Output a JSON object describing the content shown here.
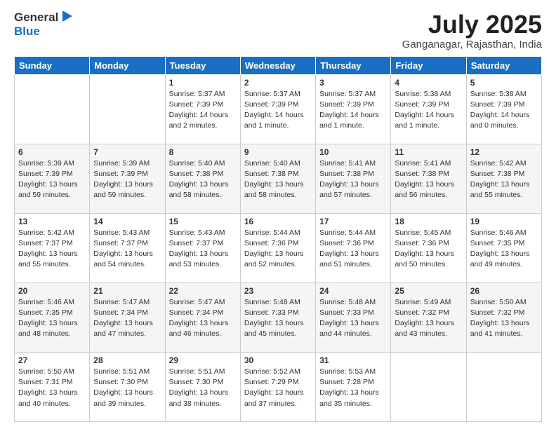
{
  "header": {
    "logo_line1": "General",
    "logo_line2": "Blue",
    "month_title": "July 2025",
    "subtitle": "Ganganagar, Rajasthan, India"
  },
  "days_of_week": [
    "Sunday",
    "Monday",
    "Tuesday",
    "Wednesday",
    "Thursday",
    "Friday",
    "Saturday"
  ],
  "weeks": [
    [
      {
        "day": "",
        "info": ""
      },
      {
        "day": "",
        "info": ""
      },
      {
        "day": "1",
        "info": "Sunrise: 5:37 AM\nSunset: 7:39 PM\nDaylight: 14 hours\nand 2 minutes."
      },
      {
        "day": "2",
        "info": "Sunrise: 5:37 AM\nSunset: 7:39 PM\nDaylight: 14 hours\nand 1 minute."
      },
      {
        "day": "3",
        "info": "Sunrise: 5:37 AM\nSunset: 7:39 PM\nDaylight: 14 hours\nand 1 minute."
      },
      {
        "day": "4",
        "info": "Sunrise: 5:38 AM\nSunset: 7:39 PM\nDaylight: 14 hours\nand 1 minute."
      },
      {
        "day": "5",
        "info": "Sunrise: 5:38 AM\nSunset: 7:39 PM\nDaylight: 14 hours\nand 0 minutes."
      }
    ],
    [
      {
        "day": "6",
        "info": "Sunrise: 5:39 AM\nSunset: 7:39 PM\nDaylight: 13 hours\nand 59 minutes."
      },
      {
        "day": "7",
        "info": "Sunrise: 5:39 AM\nSunset: 7:39 PM\nDaylight: 13 hours\nand 59 minutes."
      },
      {
        "day": "8",
        "info": "Sunrise: 5:40 AM\nSunset: 7:38 PM\nDaylight: 13 hours\nand 58 minutes."
      },
      {
        "day": "9",
        "info": "Sunrise: 5:40 AM\nSunset: 7:38 PM\nDaylight: 13 hours\nand 58 minutes."
      },
      {
        "day": "10",
        "info": "Sunrise: 5:41 AM\nSunset: 7:38 PM\nDaylight: 13 hours\nand 57 minutes."
      },
      {
        "day": "11",
        "info": "Sunrise: 5:41 AM\nSunset: 7:38 PM\nDaylight: 13 hours\nand 56 minutes."
      },
      {
        "day": "12",
        "info": "Sunrise: 5:42 AM\nSunset: 7:38 PM\nDaylight: 13 hours\nand 55 minutes."
      }
    ],
    [
      {
        "day": "13",
        "info": "Sunrise: 5:42 AM\nSunset: 7:37 PM\nDaylight: 13 hours\nand 55 minutes."
      },
      {
        "day": "14",
        "info": "Sunrise: 5:43 AM\nSunset: 7:37 PM\nDaylight: 13 hours\nand 54 minutes."
      },
      {
        "day": "15",
        "info": "Sunrise: 5:43 AM\nSunset: 7:37 PM\nDaylight: 13 hours\nand 53 minutes."
      },
      {
        "day": "16",
        "info": "Sunrise: 5:44 AM\nSunset: 7:36 PM\nDaylight: 13 hours\nand 52 minutes."
      },
      {
        "day": "17",
        "info": "Sunrise: 5:44 AM\nSunset: 7:36 PM\nDaylight: 13 hours\nand 51 minutes."
      },
      {
        "day": "18",
        "info": "Sunrise: 5:45 AM\nSunset: 7:36 PM\nDaylight: 13 hours\nand 50 minutes."
      },
      {
        "day": "19",
        "info": "Sunrise: 5:46 AM\nSunset: 7:35 PM\nDaylight: 13 hours\nand 49 minutes."
      }
    ],
    [
      {
        "day": "20",
        "info": "Sunrise: 5:46 AM\nSunset: 7:35 PM\nDaylight: 13 hours\nand 48 minutes."
      },
      {
        "day": "21",
        "info": "Sunrise: 5:47 AM\nSunset: 7:34 PM\nDaylight: 13 hours\nand 47 minutes."
      },
      {
        "day": "22",
        "info": "Sunrise: 5:47 AM\nSunset: 7:34 PM\nDaylight: 13 hours\nand 46 minutes."
      },
      {
        "day": "23",
        "info": "Sunrise: 5:48 AM\nSunset: 7:33 PM\nDaylight: 13 hours\nand 45 minutes."
      },
      {
        "day": "24",
        "info": "Sunrise: 5:48 AM\nSunset: 7:33 PM\nDaylight: 13 hours\nand 44 minutes."
      },
      {
        "day": "25",
        "info": "Sunrise: 5:49 AM\nSunset: 7:32 PM\nDaylight: 13 hours\nand 43 minutes."
      },
      {
        "day": "26",
        "info": "Sunrise: 5:50 AM\nSunset: 7:32 PM\nDaylight: 13 hours\nand 41 minutes."
      }
    ],
    [
      {
        "day": "27",
        "info": "Sunrise: 5:50 AM\nSunset: 7:31 PM\nDaylight: 13 hours\nand 40 minutes."
      },
      {
        "day": "28",
        "info": "Sunrise: 5:51 AM\nSunset: 7:30 PM\nDaylight: 13 hours\nand 39 minutes."
      },
      {
        "day": "29",
        "info": "Sunrise: 5:51 AM\nSunset: 7:30 PM\nDaylight: 13 hours\nand 38 minutes."
      },
      {
        "day": "30",
        "info": "Sunrise: 5:52 AM\nSunset: 7:29 PM\nDaylight: 13 hours\nand 37 minutes."
      },
      {
        "day": "31",
        "info": "Sunrise: 5:53 AM\nSunset: 7:28 PM\nDaylight: 13 hours\nand 35 minutes."
      },
      {
        "day": "",
        "info": ""
      },
      {
        "day": "",
        "info": ""
      }
    ]
  ]
}
